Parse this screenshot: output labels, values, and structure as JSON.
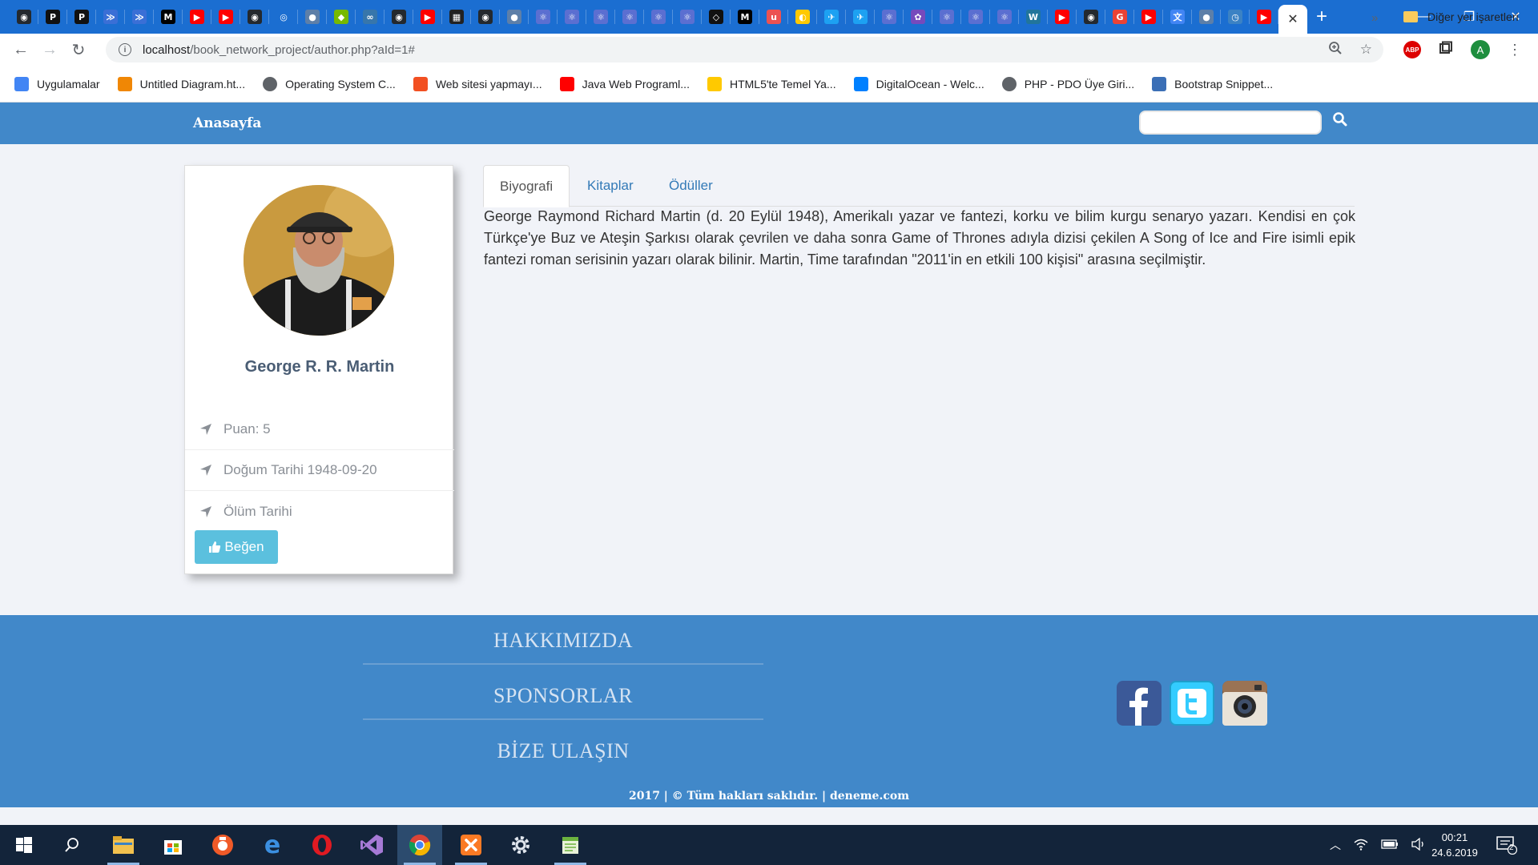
{
  "browser": {
    "active_tab_close": "✕",
    "new_tab": "+",
    "url_host": "localhost",
    "url_path": "/book_network_project/author.php?aId=1#",
    "profile_initial": "A",
    "abp_label": "ABP",
    "pinned_tabs": [
      {
        "icon": "github-icon",
        "color": "#24292e",
        "glyph": "◉"
      },
      {
        "icon": "p-icon",
        "color": "#111111",
        "glyph": "P"
      },
      {
        "icon": "p-icon",
        "color": "#111111",
        "glyph": "P"
      },
      {
        "icon": "hackerrank-icon",
        "color": "#3a6fd6",
        "glyph": "≫"
      },
      {
        "icon": "hackerrank-icon",
        "color": "#3a6fd6",
        "glyph": "≫"
      },
      {
        "icon": "medium-icon",
        "color": "#000000",
        "glyph": "M"
      },
      {
        "icon": "youtube-icon",
        "color": "#ff0000",
        "glyph": "▶"
      },
      {
        "icon": "youtube-icon",
        "color": "#ff0000",
        "glyph": "▶"
      },
      {
        "icon": "github-icon",
        "color": "#24292e",
        "glyph": "◉"
      },
      {
        "icon": "target-icon",
        "color": "#1b6ed1",
        "glyph": "◎"
      },
      {
        "icon": "globe-icon",
        "color": "#5d7fa8",
        "glyph": "●"
      },
      {
        "icon": "nvidia-icon",
        "color": "#76b900",
        "glyph": "◆"
      },
      {
        "icon": "python-icon",
        "color": "#3776ab",
        "glyph": "∞"
      },
      {
        "icon": "github-icon",
        "color": "#24292e",
        "glyph": "◉"
      },
      {
        "icon": "youtube-icon",
        "color": "#ff0000",
        "glyph": "▶"
      },
      {
        "icon": "film-icon",
        "color": "#222222",
        "glyph": "▦"
      },
      {
        "icon": "github-icon",
        "color": "#24292e",
        "glyph": "◉"
      },
      {
        "icon": "globe-icon",
        "color": "#5d7fa8",
        "glyph": "●"
      },
      {
        "icon": "react-icon",
        "color": "#5b6fd1",
        "glyph": "⚛"
      },
      {
        "icon": "react-icon",
        "color": "#5b6fd1",
        "glyph": "⚛"
      },
      {
        "icon": "react-icon",
        "color": "#5b6fd1",
        "glyph": "⚛"
      },
      {
        "icon": "react-icon",
        "color": "#5b6fd1",
        "glyph": "⚛"
      },
      {
        "icon": "react-icon",
        "color": "#5b6fd1",
        "glyph": "⚛"
      },
      {
        "icon": "react-icon",
        "color": "#5b6fd1",
        "glyph": "⚛"
      },
      {
        "icon": "codepen-icon",
        "color": "#111111",
        "glyph": "◇"
      },
      {
        "icon": "medium-icon",
        "color": "#000000",
        "glyph": "M"
      },
      {
        "icon": "udemy-icon",
        "color": "#ec5252",
        "glyph": "u"
      },
      {
        "icon": "turkcell-icon",
        "color": "#ffc900",
        "glyph": "◐"
      },
      {
        "icon": "twitter-icon",
        "color": "#1da1f2",
        "glyph": "✈"
      },
      {
        "icon": "twitter-icon",
        "color": "#1da1f2",
        "glyph": "✈"
      },
      {
        "icon": "react-icon",
        "color": "#5b6fd1",
        "glyph": "⚛"
      },
      {
        "icon": "redux-icon",
        "color": "#764abc",
        "glyph": "✿"
      },
      {
        "icon": "react-icon",
        "color": "#5b6fd1",
        "glyph": "⚛"
      },
      {
        "icon": "react-icon",
        "color": "#5b6fd1",
        "glyph": "⚛"
      },
      {
        "icon": "react-icon",
        "color": "#5b6fd1",
        "glyph": "⚛"
      },
      {
        "icon": "wordpress-icon",
        "color": "#21759b",
        "glyph": "W"
      },
      {
        "icon": "youtube-icon",
        "color": "#ff0000",
        "glyph": "▶"
      },
      {
        "icon": "github-icon",
        "color": "#24292e",
        "glyph": "◉"
      },
      {
        "icon": "google-icon",
        "color": "#ea4335",
        "glyph": "G"
      },
      {
        "icon": "youtube-icon",
        "color": "#ff0000",
        "glyph": "▶"
      },
      {
        "icon": "translate-icon",
        "color": "#4285f4",
        "glyph": "文"
      },
      {
        "icon": "globe-icon",
        "color": "#5d7fa8",
        "glyph": "●"
      },
      {
        "icon": "clock-icon",
        "color": "#3b82c4",
        "glyph": "◷"
      },
      {
        "icon": "youtube-icon",
        "color": "#ff0000",
        "glyph": "▶"
      }
    ]
  },
  "bookmarks": {
    "items": [
      {
        "label": "Uygulamalar",
        "icon": "apps-grid-icon",
        "color": "#4285f4"
      },
      {
        "label": "Untitled Diagram.ht...",
        "icon": "drawio-icon",
        "color": "#f08705"
      },
      {
        "label": "Operating System C...",
        "icon": "globe-icon",
        "color": "#5f6368"
      },
      {
        "label": "Web sitesi yapmayı...",
        "icon": "microsoft-icon",
        "color": "#f25022"
      },
      {
        "label": "Java Web Programl...",
        "icon": "youtube-icon",
        "color": "#ff0000"
      },
      {
        "label": "HTML5'te Temel Ya...",
        "icon": "turkcell-icon",
        "color": "#ffc900"
      },
      {
        "label": "DigitalOcean - Welc...",
        "icon": "digitalocean-icon",
        "color": "#0080ff"
      },
      {
        "label": "PHP - PDO Üye Giri...",
        "icon": "globe-icon",
        "color": "#5f6368"
      },
      {
        "label": "Bootstrap Snippet...",
        "icon": "bootstrap-icon",
        "color": "#3b6fb6"
      }
    ],
    "more": "»",
    "other_label": "Diğer yer işaretleri"
  },
  "site": {
    "nav_home": "Anasayfa",
    "search_placeholder": "",
    "author": {
      "name": "George R. R. Martin",
      "rating": "Puan: 5",
      "birth": "Doğum Tarihi 1948-09-20",
      "death": "Ölüm Tarihi",
      "like_button": "Beğen"
    },
    "tabs": [
      "Biyografi",
      "Kitaplar",
      "Ödüller"
    ],
    "active_tab": "Biyografi",
    "biography": "George Raymond Richard Martin (d. 20 Eylül 1948), Amerikalı yazar ve fantezi, korku ve bilim kurgu senaryo yazarı. Kendisi en çok Türkçe'ye Buz ve Ateşin Şarkısı olarak çevrilen ve daha sonra Game of Thrones adıyla dizisi çekilen A Song of Ice and Fire isimli epik fantezi roman serisinin yazarı olarak bilinir. Martin, Time tarafından \"2011'in en etkili 100 kişisi\" arasına seçilmiştir.",
    "footer": {
      "links": [
        "HAKKIMIZDA",
        "SPONSORLAR",
        "BİZE ULAŞIN"
      ],
      "social": [
        "facebook-icon",
        "twitter-icon",
        "instagram-icon"
      ],
      "copyright": "2017 | © Tüm hakları saklıdır. | deneme.com"
    },
    "colors": {
      "accent": "#4188c9",
      "info_button": "#5bc0de",
      "link": "#337ab7"
    }
  },
  "taskbar": {
    "time": "00:21",
    "date": "24.6.2019",
    "notification_count": "2",
    "apps": [
      "windows-start-icon",
      "search-icon",
      "file-explorer-icon",
      "store-icon",
      "snip-icon",
      "edge-icon",
      "opera-icon",
      "visual-studio-icon",
      "chrome-icon",
      "xampp-icon",
      "settings-icon",
      "notepad-icon"
    ]
  }
}
